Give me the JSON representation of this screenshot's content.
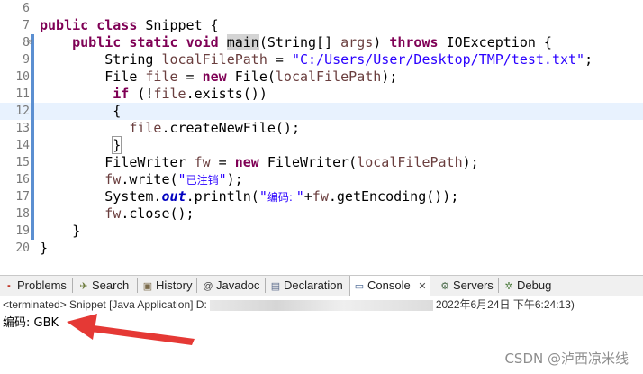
{
  "editor": {
    "lines": [
      {
        "num": "6"
      },
      {
        "num": "7",
        "c": [
          "public class Snippet {"
        ]
      },
      {
        "num": "8",
        "c": [
          "public static void main(String[] args) throws IOException {"
        ]
      },
      {
        "num": "9",
        "c": [
          "String localFilePath = \"C:/Users/User/Desktop/TMP/test.txt\";"
        ]
      },
      {
        "num": "10",
        "c": [
          "File file = new File(localFilePath);"
        ]
      },
      {
        "num": "11",
        "c": [
          "if (!file.exists())"
        ]
      },
      {
        "num": "12",
        "c": [
          "{"
        ]
      },
      {
        "num": "13",
        "c": [
          "file.createNewFile();"
        ]
      },
      {
        "num": "14",
        "c": [
          "}"
        ]
      },
      {
        "num": "15",
        "c": [
          "FileWriter fw = new FileWriter(localFilePath);"
        ]
      },
      {
        "num": "16",
        "c": [
          "fw.write(\"已注销\");"
        ]
      },
      {
        "num": "17",
        "c": [
          "System.out.println(\"编码: \"+fw.getEncoding());"
        ]
      },
      {
        "num": "18",
        "c": [
          "fw.close();"
        ]
      },
      {
        "num": "19",
        "c": [
          "}"
        ]
      },
      {
        "num": "20",
        "c": [
          "}"
        ]
      }
    ]
  },
  "tabs": [
    {
      "label": "Problems",
      "icon": "problems-icon",
      "glyph": "▪",
      "color": "#c0392b"
    },
    {
      "label": "Search",
      "icon": "search-icon",
      "glyph": "✈",
      "color": "#6b7a3a"
    },
    {
      "label": "History",
      "icon": "history-icon",
      "glyph": "▣",
      "color": "#7a6a4a"
    },
    {
      "label": "Javadoc",
      "icon": "javadoc-icon",
      "glyph": "@",
      "color": "#444444"
    },
    {
      "label": "Declaration",
      "icon": "declaration-icon",
      "glyph": "▤",
      "color": "#5a6a8a"
    },
    {
      "label": "Console",
      "icon": "console-icon",
      "glyph": "▭",
      "color": "#3a5a8a",
      "close": "✕"
    },
    {
      "label": "Servers",
      "icon": "servers-icon",
      "glyph": "⚙",
      "color": "#4a6a4a"
    },
    {
      "label": "Debug",
      "icon": "debug-icon",
      "glyph": "✲",
      "color": "#4a7a3a"
    }
  ],
  "console": {
    "status_prefix": "<terminated> Snippet [Java Application] D:",
    "status_suffix": "2022年6月24日 下午6:24:13)",
    "output": "编码: GBK"
  },
  "watermark": "CSDN @泸西凉米线",
  "colors": {
    "keyword": "#7f0055",
    "string": "#2a00ff",
    "field": "#0000c0",
    "local_var": "#6a3e3e",
    "arrow": "#e53935",
    "current_line": "#e8f2fe"
  }
}
